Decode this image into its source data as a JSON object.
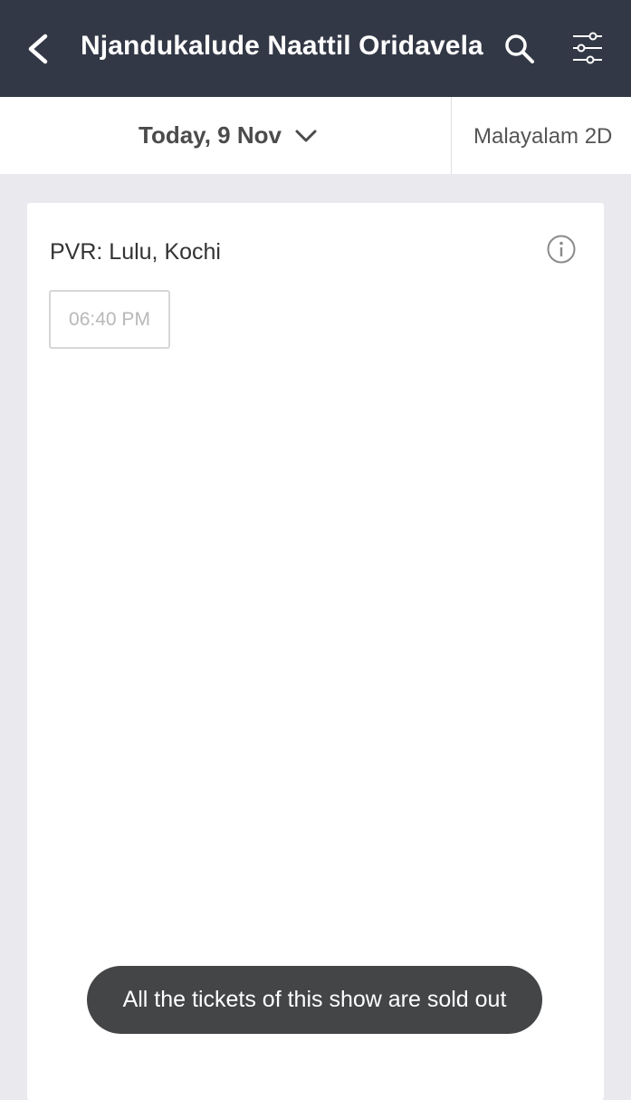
{
  "header": {
    "title": "Njandukalude Naattil Oridavela",
    "back_icon": "chevron-left-icon",
    "search_icon": "search-icon",
    "filter_icon": "filter-sliders-icon"
  },
  "subbar": {
    "date_label": "Today, 9 Nov",
    "date_icon": "chevron-down-icon",
    "format_label": "Malayalam 2D"
  },
  "venue": {
    "name": "PVR: Lulu, Kochi",
    "info_icon": "info-icon",
    "showtimes": [
      {
        "time": "06:40 PM",
        "status": "sold-out"
      }
    ]
  },
  "toast": {
    "message": "All the tickets of this show are sold out"
  },
  "colors": {
    "header_bg": "#333846",
    "page_bg": "#e9e9ee",
    "toast_bg": "#444547"
  }
}
